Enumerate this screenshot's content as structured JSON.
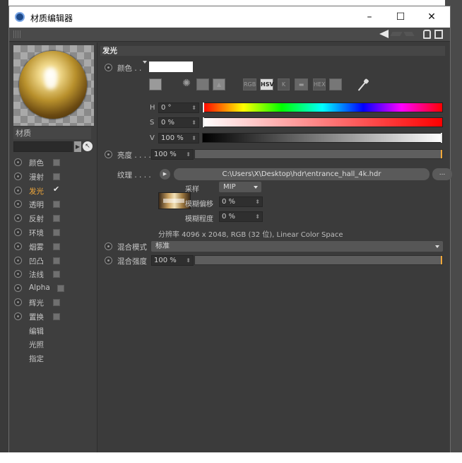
{
  "window": {
    "title": "材质编辑器",
    "controls": {
      "minimize": "–",
      "maximize": "☐",
      "close": "✕"
    }
  },
  "material": {
    "name": "材质"
  },
  "channels": [
    {
      "label": "颜色",
      "checked": false
    },
    {
      "label": "漫射",
      "checked": false
    },
    {
      "label": "发光",
      "checked": true,
      "active": true
    },
    {
      "label": "透明",
      "checked": false
    },
    {
      "label": "反射",
      "checked": false
    },
    {
      "label": "环境",
      "checked": false
    },
    {
      "label": "烟雾",
      "checked": false
    },
    {
      "label": "凹凸",
      "checked": false
    },
    {
      "label": "法线",
      "checked": false
    },
    {
      "label": "Alpha",
      "checked": false
    },
    {
      "label": "辉光",
      "checked": false
    },
    {
      "label": "置换",
      "checked": false
    }
  ],
  "extra_tabs": [
    "编辑",
    "光照",
    "指定"
  ],
  "section": {
    "title": "发光",
    "color_label": "颜色 . .",
    "color_value": "#ffffff",
    "color_modes": [
      "RGB",
      "HSV",
      "K",
      "HEX"
    ],
    "active_mode": "HSV",
    "hsv": {
      "h": {
        "label": "H",
        "value": "0 °"
      },
      "s": {
        "label": "S",
        "value": "0 %"
      },
      "v": {
        "label": "V",
        "value": "100 %"
      }
    },
    "brightness": {
      "label": "亮度 . . . .",
      "value": "100 %"
    },
    "texture": {
      "label": "纹理 . . . .",
      "path": "C:\\Users\\X\\Desktop\\hdr\\entrance_hall_4k.hdr",
      "browse": "...",
      "sampling_label": "采样",
      "sampling_value": "MIP",
      "blur_offset_label": "模糊偏移",
      "blur_offset_value": "0 %",
      "blur_scale_label": "模糊程度",
      "blur_scale_value": "0 %",
      "info": "分辨率 4096 x 2048, RGB (32 位), Linear Color Space"
    },
    "mix_mode": {
      "label": "混合模式",
      "value": "标准"
    },
    "mix_strength": {
      "label": "混合强度",
      "value": "100 %"
    }
  }
}
